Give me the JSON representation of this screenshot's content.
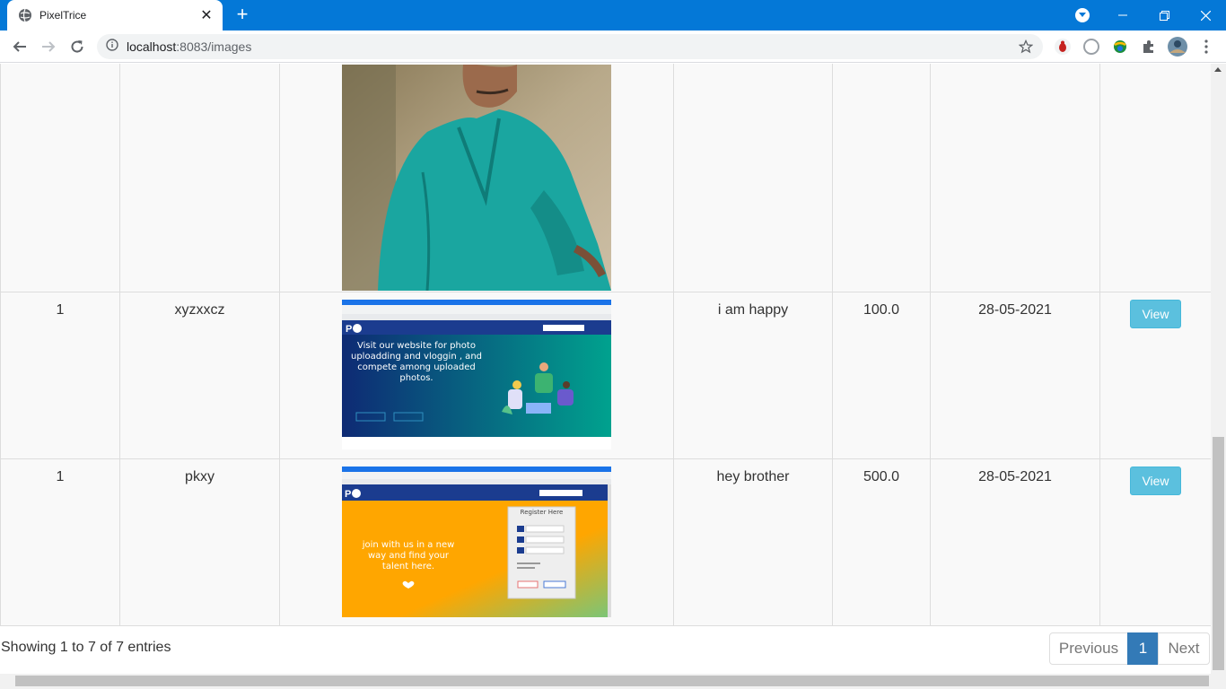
{
  "browser": {
    "tab_title": "PixelTrice",
    "url_host": "localhost",
    "url_rest": ":8083/images",
    "new_tab_label": "+",
    "close_label": "✕"
  },
  "table": {
    "rows": [
      {
        "id": "1",
        "name": "xyzxxcz",
        "caption": "i am happy",
        "price": "100.0",
        "date": "28-05-2021",
        "action": "View",
        "image": {
          "type": "site-banner",
          "text": "Visit our website for photo uploadding and vloggin , and compete among uploaded photos.",
          "accent": "#0e2a74"
        }
      },
      {
        "id": "1",
        "name": "pkxy",
        "caption": "hey brother",
        "price": "500.0",
        "date": "28-05-2021",
        "action": "View",
        "image": {
          "type": "register-page",
          "text": "join with us in a new way and find your talent here.",
          "form_title": "Register Here",
          "accent": "#ffa600"
        }
      }
    ]
  },
  "footer": {
    "info": "Showing 1 to 7 of 7 entries",
    "pagination": {
      "previous": "Previous",
      "current": "1",
      "next": "Next"
    }
  },
  "colors": {
    "chrome": "#0478d7",
    "view_button": "#5bc0de",
    "active_page": "#337ab7"
  }
}
